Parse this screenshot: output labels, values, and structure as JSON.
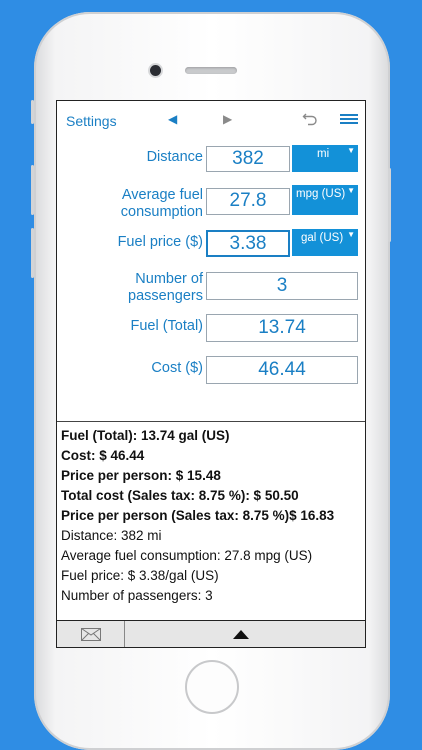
{
  "navbar": {
    "settings_label": "Settings",
    "prev_icon": "left-arrow-icon",
    "next_icon": "right-arrow-icon",
    "undo_icon": "undo-icon",
    "menu_icon": "menu-icon"
  },
  "form": {
    "distance": {
      "label": "Distance",
      "value": "382",
      "unit": "mi"
    },
    "consumption": {
      "label_line1": "Average fuel",
      "label_line2": "consumption",
      "value": "27.8",
      "unit": "mpg (US)"
    },
    "fuel_price": {
      "label": "Fuel price ($)",
      "value": "3.38",
      "unit": "gal (US)"
    },
    "passengers": {
      "label_line1": "Number of",
      "label_line2": "passengers",
      "value": "3"
    },
    "fuel_total": {
      "label": "Fuel (Total)",
      "value": "13.74"
    },
    "cost": {
      "label": "Cost ($)",
      "value": "46.44"
    }
  },
  "results": {
    "fuel_total": "Fuel (Total): 13.74 gal (US)",
    "cost": "Cost: $ 46.44",
    "price_per_person": "Price per person: $ 15.48",
    "total_cost_tax": "Total cost (Sales tax: 8.75 %): $ 50.50",
    "price_per_person_tax": "Price per person (Sales tax: 8.75 %)$ 16.83",
    "distance": "Distance: 382 mi",
    "avg_consumption": "Average fuel consumption: 27.8 mpg (US)",
    "fuel_price": "Fuel price: $ 3.38/gal (US)",
    "passengers": "Number of passengers: 3"
  },
  "bottom_bar": {
    "mail_icon": "mail-icon",
    "expand_icon": "triangle-up-icon"
  },
  "colors": {
    "background": "#2f8de4",
    "accent": "#1a7fc4",
    "unit_button": "#1391d8"
  }
}
